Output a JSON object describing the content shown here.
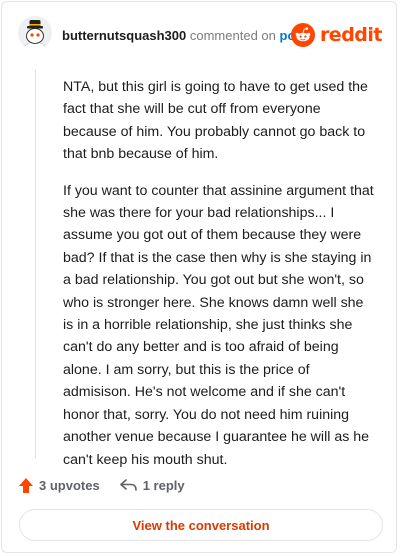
{
  "header": {
    "username": "butternutsquash300",
    "action_text": "commented on",
    "post_link": "post",
    "brand": "reddit"
  },
  "comment": {
    "paragraphs": [
      "NTA, but this girl is going to have to get used the fact that she will be cut off from everyone because of him. You probably cannot go back to that bnb because of him.",
      "If you want to counter that assinine argument that she was there for your bad relationships... I assume you got out of them because they were bad? If that is the case then why is she staying in a bad relationship. You got out but she won't, so who is stronger here. She knows damn well she is in a horrible relationship, she just thinks she can't do any better and is too afraid of being alone. I am sorry, but this is the price of admisison. He's not welcome and if she can't honor that, sorry. You do not need him ruining another venue because I guarantee he will as he can't keep his mouth shut."
    ]
  },
  "actions": {
    "upvotes": "3 upvotes",
    "replies": "1 reply"
  },
  "footer": {
    "view_button": "View the conversation"
  },
  "colors": {
    "brand": "#ff4500",
    "link": "#0079d3",
    "button_text": "#d93a00"
  },
  "icons": [
    "avatar",
    "reddit-logo-icon",
    "upvote-arrow-icon",
    "reply-arrow-icon"
  ]
}
